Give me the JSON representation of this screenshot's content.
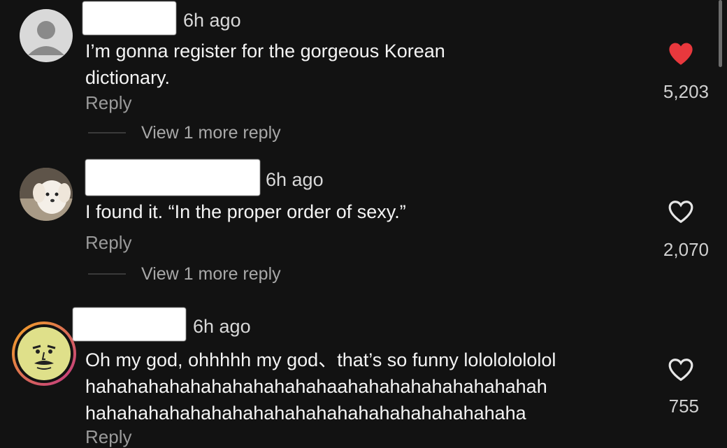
{
  "comments": [
    {
      "time": "6h ago",
      "text": "I’m gonna register for the gorgeous Korean\ndictionary.",
      "reply_label": "Reply",
      "view_more": "View 1 more reply",
      "likes": "5,203",
      "liked": true
    },
    {
      "time": "6h ago",
      "text": "I found it. “In the proper order of sexy.”",
      "reply_label": "Reply",
      "view_more": "View 1 more reply",
      "likes": "2,070",
      "liked": false
    },
    {
      "time": "6h ago",
      "text": "Oh my god, ohhhhh my god、that’s so funny lolololololol\nhahahahahahahahahahahahaahahahahahahahahahah\nhahahahahahahahahahahahahahahahahahahahaha",
      "reply_label": "Reply",
      "likes": "755",
      "liked": false
    }
  ],
  "colors": {
    "background": "#121212",
    "liked_heart": "#e8383d",
    "story_ring_start": "#f5a623",
    "story_ring_end": "#c13584"
  }
}
